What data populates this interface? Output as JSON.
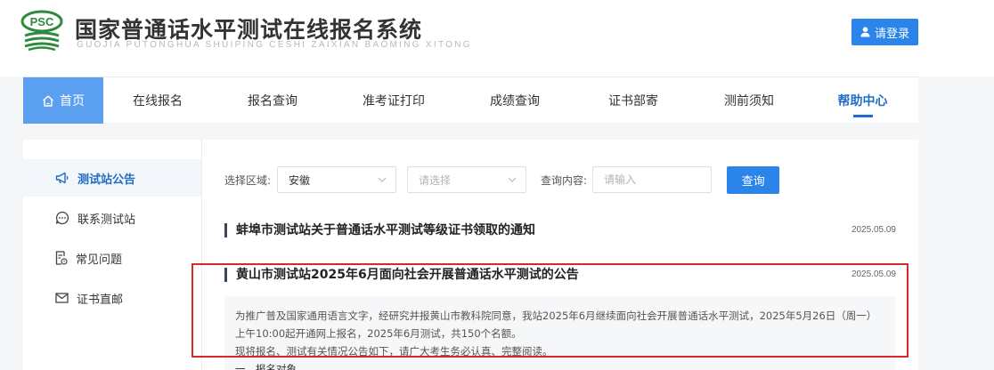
{
  "header": {
    "logo_text": "PSC",
    "title_cn": "国家普通话水平测试在线报名系统",
    "title_en": "GUOJIA PUTONGHUA SHUIPING CESHI ZAIXIAN BAOMING XITONG",
    "login_label": "请登录"
  },
  "nav": {
    "items": [
      {
        "label": "首页",
        "icon": "home-icon"
      },
      {
        "label": "在线报名"
      },
      {
        "label": "报名查询"
      },
      {
        "label": "准考证打印"
      },
      {
        "label": "成绩查询"
      },
      {
        "label": "证书部寄"
      },
      {
        "label": "测前须知"
      },
      {
        "label": "帮助中心"
      }
    ],
    "active_index": 7
  },
  "sidebar": {
    "items": [
      {
        "label": "测试站公告",
        "icon": "megaphone-icon",
        "active": true
      },
      {
        "label": "联系测试站",
        "icon": "chat-icon"
      },
      {
        "label": "常见问题",
        "icon": "faq-document-icon"
      },
      {
        "label": "证书直邮",
        "icon": "mail-icon"
      }
    ]
  },
  "filters": {
    "region_label": "选择区域:",
    "province_value": "安徽",
    "city_placeholder": "请选择",
    "query_label": "查询内容:",
    "query_placeholder": "请输入",
    "query_button": "查询"
  },
  "news": [
    {
      "title": "蚌埠市测试站关于普通话水平测试等级证书领取的通知",
      "date": "2025.05.09"
    },
    {
      "title": "黄山市测试站2025年6月面向社会开展普通话水平测试的公告",
      "date": "2025.05.09"
    }
  ],
  "summary": {
    "line1": "为推广普及国家通用语言文字，经研究并报黄山市教科院同意，我站2025年6月继续面向社会开展普通话水平测试，2025年5月26日（周一）",
    "line2": "上午10:00起开通网上报名，2025年6月测试，共150个名额。",
    "line3": "现将报名、测试有关情况公告如下，请广大考生务必认真、完整阅读。",
    "line4": "一、报名对象"
  },
  "colors": {
    "brand_blue": "#2b84e9",
    "nav_home_bg": "#5b9ff0",
    "active_text": "#1f6dc4",
    "logo_green": "#2e8b3d",
    "highlight_red": "#d9272e"
  }
}
